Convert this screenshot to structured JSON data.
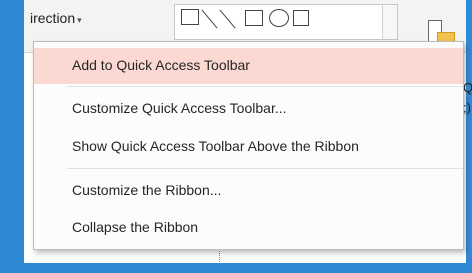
{
  "ribbon": {
    "direction_label": "irection",
    "direction_caret": "▾",
    "edge_text_1": "Q",
    "edge_text_2": ";)"
  },
  "menu": {
    "items": [
      {
        "label": "Add to Quick Access Toolbar"
      },
      {
        "label": "Customize Quick Access Toolbar..."
      },
      {
        "label": "Show Quick Access Toolbar Above the Ribbon"
      },
      {
        "label": "Customize the Ribbon..."
      },
      {
        "label": "Collapse the Ribbon"
      }
    ]
  },
  "colors": {
    "frame": "#2f8ad6",
    "hover": "#fbd8d2"
  }
}
